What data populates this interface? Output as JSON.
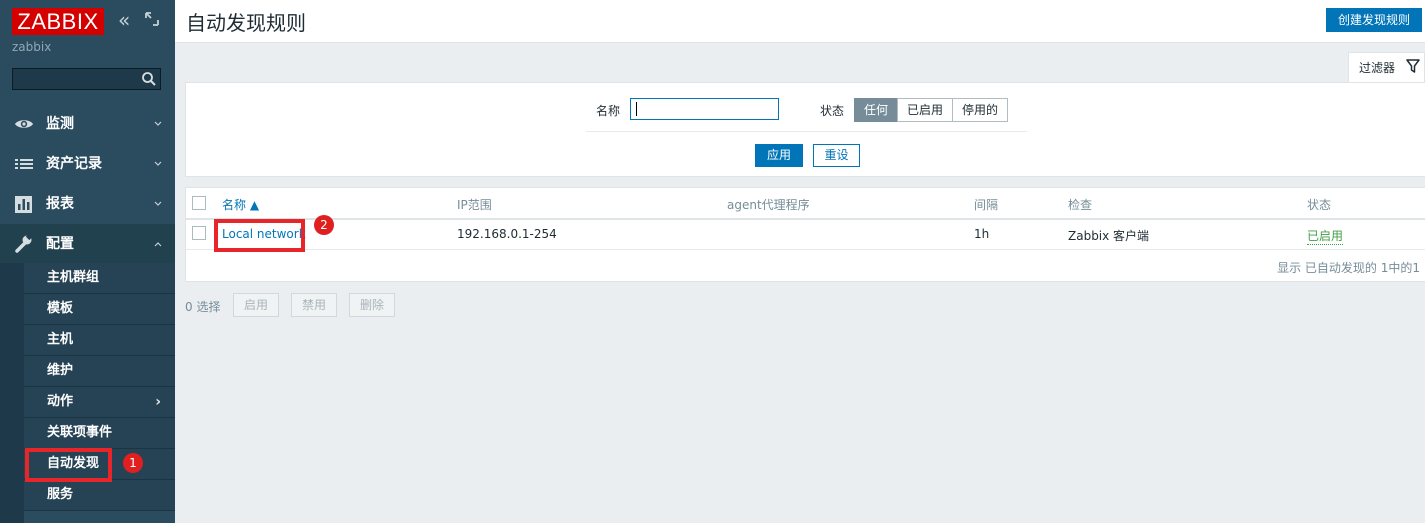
{
  "sidebar": {
    "logo": "ZABBIX",
    "server_name": "zabbix",
    "collapse_glyph": "«",
    "search_placeholder": "",
    "menu": [
      {
        "label": "监测",
        "icon": "eye-icon"
      },
      {
        "label": "资产记录",
        "icon": "list-icon"
      },
      {
        "label": "报表",
        "icon": "bar-chart-icon"
      },
      {
        "label": "配置",
        "icon": "wrench-icon"
      }
    ],
    "config_submenu": [
      "主机群组",
      "模板",
      "主机",
      "维护",
      "动作",
      "关联项事件",
      "自动发现",
      "服务"
    ],
    "submenu_arrow": "›"
  },
  "header": {
    "title": "自动发现规则",
    "create_button": "创建发现规则"
  },
  "filter": {
    "tab_label": "过滤器",
    "name_label": "名称",
    "name_value": "",
    "status_label": "状态",
    "status_options": [
      "任何",
      "已启用",
      "停用的"
    ],
    "status_selected": "任何",
    "apply_button": "应用",
    "reset_button": "重设"
  },
  "table": {
    "columns": [
      "名称 ▲",
      "IP范围",
      "agent代理程序",
      "间隔",
      "检查",
      "状态"
    ],
    "rows": [
      {
        "name": "Local network",
        "ip_range": "192.168.0.1-254",
        "proxy": "",
        "interval": "1h",
        "checks": "Zabbix 客户端",
        "status": "已启用"
      }
    ],
    "footer": "显示 已自动发现的 1中的1"
  },
  "actions": {
    "selected": "0 选择",
    "enable": "启用",
    "disable": "禁用",
    "delete": "删除"
  },
  "annotations": {
    "badge_1": "1",
    "badge_2": "2",
    "color": "#e8262a"
  },
  "colors": {
    "sidebar": "#2b4c5f",
    "accent": "#0275b8",
    "enabled": "#429e47",
    "logo": "#d40000"
  }
}
